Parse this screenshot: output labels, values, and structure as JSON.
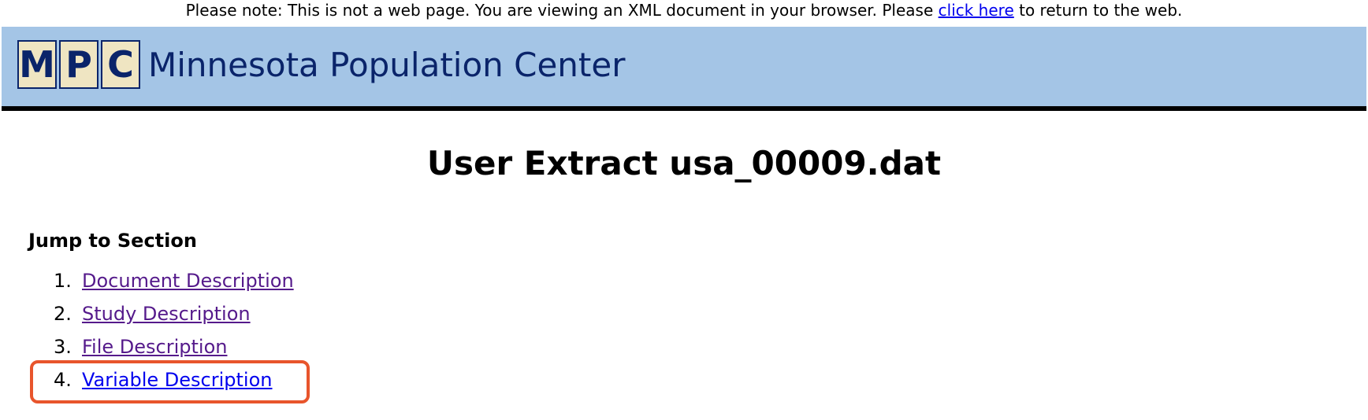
{
  "notice": {
    "prefix": "Please note: This is not a web page. You are viewing an XML document in your browser. Please",
    "link": "click here",
    "suffix": "to return to the web."
  },
  "banner": {
    "logo_letters": [
      "M",
      "P",
      "C"
    ],
    "org_name": "Minnesota Population Center",
    "background_color": "#a4c5e6",
    "text_color": "#0a246a"
  },
  "title": "User Extract usa_00009.dat",
  "jump": {
    "heading": "Jump to Section",
    "items": [
      {
        "number": "1.",
        "label": "Document Description",
        "visited": true
      },
      {
        "number": "2.",
        "label": "Study Description",
        "visited": true
      },
      {
        "number": "3.",
        "label": "File Description",
        "visited": true
      },
      {
        "number": "4.",
        "label": "Variable Description",
        "visited": false,
        "highlighted": true
      }
    ]
  },
  "highlight_color": "#e8552c"
}
